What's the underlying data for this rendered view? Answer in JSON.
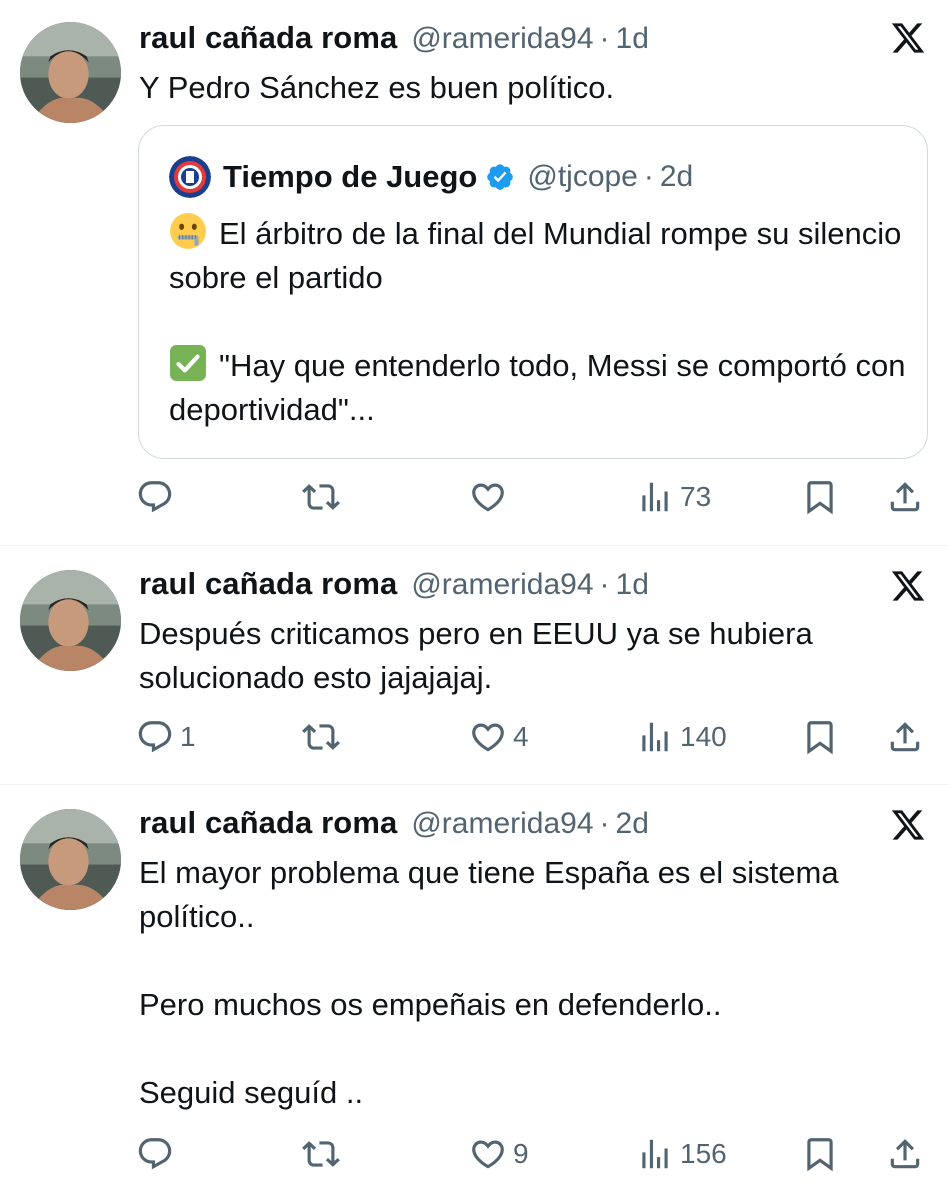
{
  "tweets": [
    {
      "name": "raul cañada  roma",
      "handle": "@ramerida94",
      "separator": "·",
      "time": "1d",
      "text": [
        "Y Pedro Sánchez es buen político."
      ],
      "quote": {
        "name": "Tiempo de Juego",
        "handle": "@tjcope",
        "separator": "·",
        "time": "2d",
        "line1_emoji": "zipper-mouth-face-emoji",
        "line1": "El árbitro de la final del Mundial rompe su silencio sobre el partido",
        "line2_emoji": "check-mark-button-emoji",
        "line2": "\"Hay que entenderlo todo, Messi se comportó con deportividad\"..."
      },
      "replies": "",
      "retweets": "",
      "likes": "",
      "views": "73"
    },
    {
      "name": "raul cañada  roma",
      "handle": "@ramerida94",
      "separator": "·",
      "time": "1d",
      "text": [
        "Después criticamos pero en EEUU ya se hubiera solucionado esto jajajajaj."
      ],
      "replies": "1",
      "retweets": "",
      "likes": "4",
      "views": "140"
    },
    {
      "name": "raul cañada  roma",
      "handle": "@ramerida94",
      "separator": "·",
      "time": "2d",
      "text": [
        "El mayor problema que tiene España es el sistema político..",
        "Pero muchos os empeñais en defenderlo..",
        "Seguid seguíd .."
      ],
      "replies": "",
      "retweets": "",
      "likes": "9",
      "views": "156"
    }
  ],
  "icons": {
    "x_logo": "x-logo-icon",
    "reply": "reply-icon",
    "retweet": "retweet-icon",
    "like": "heart-icon",
    "views": "views-icon",
    "bookmark": "bookmark-icon",
    "share": "share-icon",
    "verified": "verified-badge-icon"
  },
  "colors": {
    "text": "#0f1419",
    "secondary": "#536471",
    "verified": "#1d9bf0",
    "border": "#cfd9de"
  }
}
